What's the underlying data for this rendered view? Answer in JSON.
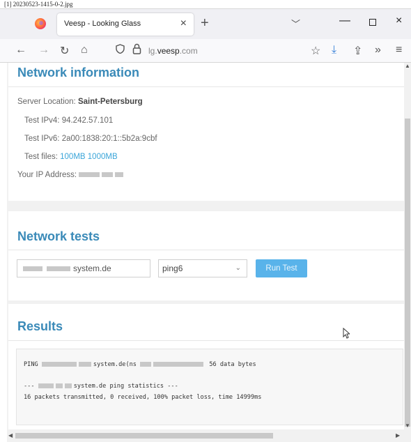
{
  "filename": "[1] 20230523-1415-0-2.jpg",
  "browser": {
    "tab_title": "Veesp - Looking Glass",
    "tab_close": "×",
    "new_tab": "+",
    "tab_list": "﹀",
    "win_min": "—",
    "win_close": "×",
    "nav": {
      "back": "←",
      "forward": "→",
      "reload": "↻",
      "home": "⌂",
      "bookmark": "☆",
      "download": "⤓",
      "share": "⇪",
      "more": "»",
      "menu": "≡"
    },
    "url_prefix": "lg.",
    "url_domain": "veesp",
    "url_suffix": ".com"
  },
  "network_info": {
    "title": "Network information",
    "server_location_label": "Server Location: ",
    "server_location_value": "Saint-Petersburg",
    "ipv4_label": "Test IPv4: ",
    "ipv4_value": "94.242.57.101",
    "ipv6_label": "Test IPv6: ",
    "ipv6_value": "2a00:1838:20:1::5b2a:9cbf",
    "files_label": "Test files: ",
    "file_1": "100MB",
    "file_2": "1000MB",
    "your_ip_label": "Your IP Address: "
  },
  "network_tests": {
    "title": "Network tests",
    "host_value": "system.de",
    "method_value": "ping6",
    "chevron": "⌄",
    "run_button": "Run Test"
  },
  "results": {
    "title": "Results",
    "line1_start": "PING",
    "line1_host": "system.de(ns",
    "line1_end": "56 data bytes",
    "line2_start": "---",
    "line2_host": "system.de ping statistics ---",
    "line3": "16 packets transmitted, 0 received, 100% packet loss, time 14999ms"
  },
  "colors": {
    "accent": "#3a8ab8",
    "button": "#59b3ea",
    "link": "#3aa5d9"
  }
}
